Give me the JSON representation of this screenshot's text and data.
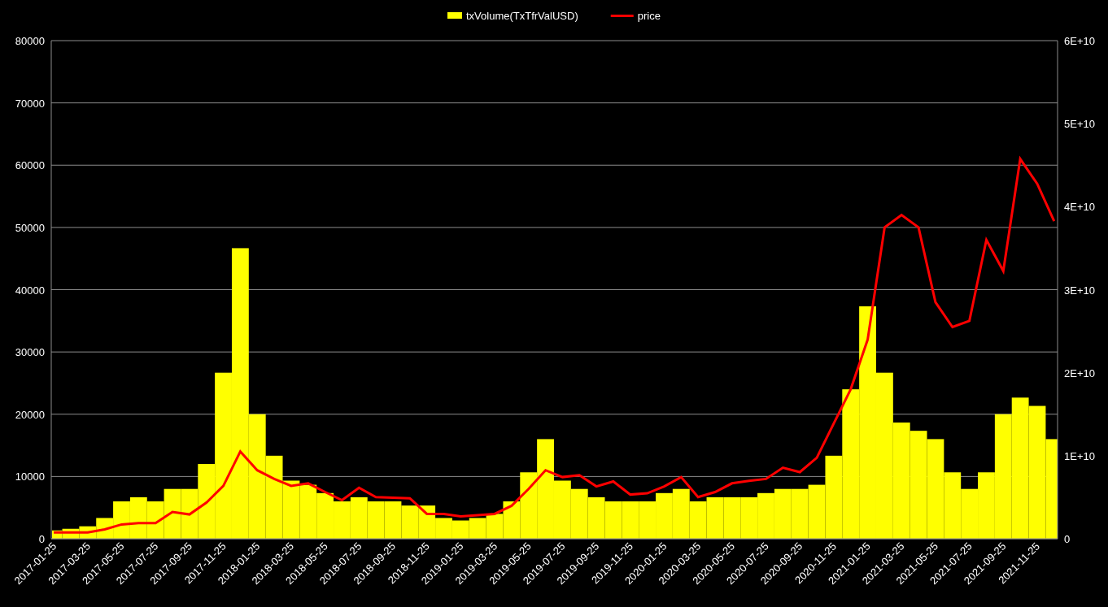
{
  "chart_data": {
    "type": "bar",
    "grid": true,
    "legend": "top",
    "categories": [
      "2017-01-25",
      null,
      "2017-03-25",
      null,
      "2017-05-25",
      null,
      "2017-07-25",
      null,
      "2017-09-25",
      null,
      "2017-11-25",
      null,
      "2018-01-25",
      null,
      "2018-03-25",
      null,
      "2018-05-25",
      null,
      "2018-07-25",
      null,
      "2018-09-25",
      null,
      "2018-11-25",
      null,
      "2019-01-25",
      null,
      "2019-03-25",
      null,
      "2019-05-25",
      null,
      "2019-07-25",
      null,
      "2019-09-25",
      null,
      "2019-11-25",
      null,
      "2020-01-25",
      null,
      "2020-03-25",
      null,
      "2020-05-25",
      null,
      "2020-07-25",
      null,
      "2020-09-25",
      null,
      "2020-11-25",
      null,
      "2021-01-25",
      null,
      "2021-03-25",
      null,
      "2021-05-25",
      null,
      "2021-07-25",
      null,
      "2021-09-25",
      null,
      "2021-11-25",
      null
    ],
    "series": [
      {
        "name": "txVolume(TxTfrValUSD)",
        "color": "#ffff00",
        "axis": "y2",
        "values": [
          1000000000.0,
          1200000000.0,
          1500000000.0,
          2500000000.0,
          4500000000.0,
          5000000000.0,
          4500000000.0,
          6000000000.0,
          6000000000.0,
          9000000000.0,
          20000000000.0,
          35000000000.0,
          15000000000.0,
          10000000000.0,
          7000000000.0,
          6500000000.0,
          5500000000.0,
          4500000000.0,
          5000000000.0,
          4500000000.0,
          4500000000.0,
          4000000000.0,
          4000000000.0,
          2500000000.0,
          2200000000.0,
          2500000000.0,
          3000000000.0,
          4500000000.0,
          8000000000.0,
          12000000000.0,
          7000000000.0,
          6000000000.0,
          5000000000.0,
          4500000000.0,
          4500000000.0,
          4500000000.0,
          5500000000.0,
          6000000000.0,
          4500000000.0,
          5000000000.0,
          5000000000.0,
          5000000000.0,
          5500000000.0,
          6000000000.0,
          6000000000.0,
          6500000000.0,
          10000000000.0,
          18000000000.0,
          28000000000.0,
          20000000000.0,
          14000000000.0,
          13000000000.0,
          12000000000.0,
          8000000000.0,
          6000000000.0,
          8000000000.0,
          15000000000.0,
          17000000000.0,
          16000000000.0,
          12000000000.0
        ]
      },
      {
        "name": "price",
        "color": "#ff0000",
        "type": "line",
        "values": [
          1000,
          1000,
          1000,
          1500,
          2300,
          2500,
          2500,
          4300,
          3900,
          5800,
          8500,
          14000,
          11000,
          9600,
          8500,
          8900,
          7500,
          6200,
          8200,
          6700,
          6600,
          6500,
          4000,
          4000,
          3600,
          3800,
          4000,
          5300,
          8000,
          11000,
          9900,
          10200,
          8400,
          9200,
          7100,
          7300,
          8400,
          9900,
          6700,
          7500,
          8900,
          9300,
          9600,
          11400,
          10700,
          13000,
          18500,
          24000,
          32000,
          50000,
          52000,
          50000,
          38000,
          34000,
          35000,
          48000,
          43000,
          61000,
          57000,
          51000
        ]
      }
    ],
    "ylim": [
      0,
      80000
    ],
    "yticks": [
      0,
      10000,
      20000,
      30000,
      40000,
      50000,
      60000,
      70000,
      80000
    ],
    "y2lim": [
      0,
      60000000000.0
    ],
    "y2ticks": [
      {
        "value": 0,
        "label": "0"
      },
      {
        "value": 10000000000.0,
        "label": "1E+10"
      },
      {
        "value": 20000000000.0,
        "label": "2E+10"
      },
      {
        "value": 30000000000.0,
        "label": "3E+10"
      },
      {
        "value": 40000000000.0,
        "label": "4E+10"
      },
      {
        "value": 50000000000.0,
        "label": "5E+10"
      },
      {
        "value": 60000000000.0,
        "label": "6E+10"
      }
    ]
  }
}
